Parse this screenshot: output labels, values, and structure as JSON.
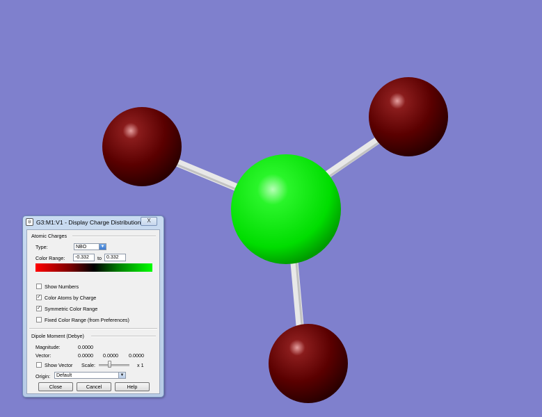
{
  "dialog": {
    "title": "G3:M1:V1 - Display Charge Distribution",
    "close_label": "X",
    "atomic_charges": {
      "group_title": "Atomic Charges",
      "type_label": "Type:",
      "type_value": "NBO",
      "color_range_label": "Color Range:",
      "range_min": "-0.332",
      "range_to": "to",
      "range_max": "0.332",
      "gradient_colors": [
        "#ff0000",
        "#000000",
        "#00ff00"
      ],
      "options": [
        {
          "label": "Show Numbers",
          "checked": false
        },
        {
          "label": "Color Atoms by Charge",
          "checked": true
        },
        {
          "label": "Symmetric Color Range",
          "checked": true
        },
        {
          "label": "Fixed Color Range (from Preferences)",
          "checked": false
        }
      ]
    },
    "dipole": {
      "group_title": "Dipole Moment (Debye)",
      "magnitude_label": "Magnitude:",
      "magnitude_value": "0.0000",
      "vector_label": "Vector:",
      "vector_values": [
        "0.0000",
        "0.0000",
        "0.0000"
      ],
      "show_vector_label": "Show Vector",
      "show_vector_checked": false,
      "scale_label": "Scale:",
      "scale_value": "x 1",
      "origin_label": "Origin:",
      "origin_value": "Default"
    },
    "buttons": {
      "close": "Close",
      "cancel": "Cancel",
      "help": "Help"
    }
  },
  "molecule": {
    "background_color": "#7f80cd",
    "central_atom_color": "#00ee00",
    "outer_atom_color": "#5a0000",
    "bond_color": "#e6e6e6"
  }
}
